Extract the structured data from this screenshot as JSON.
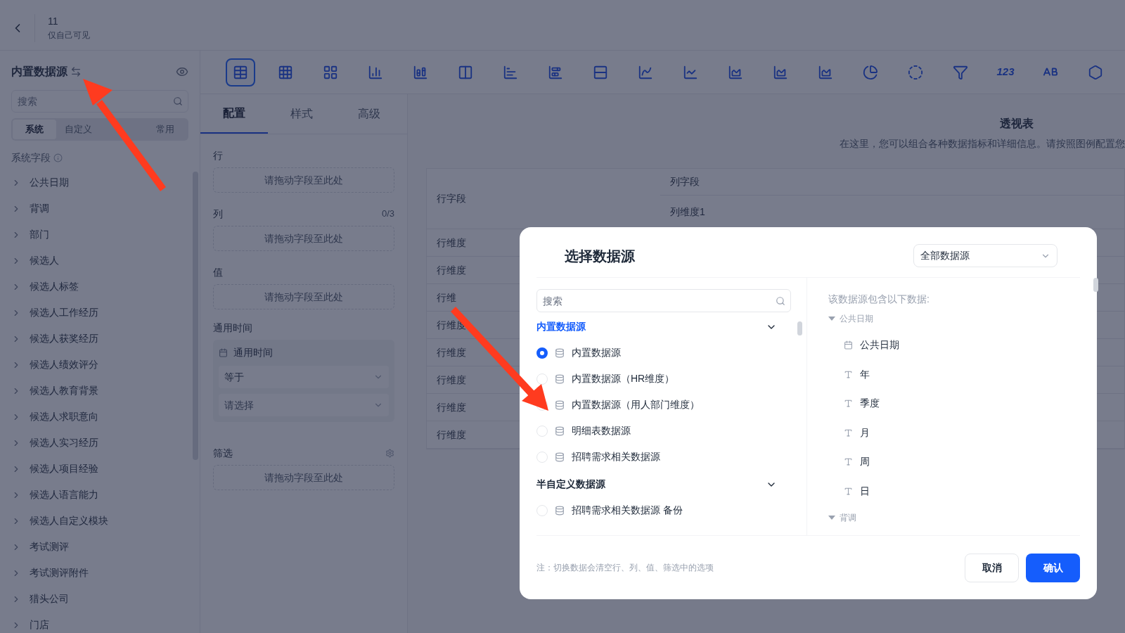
{
  "header": {
    "title": "11",
    "subtitle": "仅自己可见"
  },
  "sidebar": {
    "title": "内置数据源",
    "search": {
      "placeholder": "搜索"
    },
    "tabs": [
      {
        "label": "系统",
        "selected": true
      },
      {
        "label": "自定义",
        "selected": false
      },
      {
        "label": "常用",
        "selected": false
      }
    ],
    "section": "系统字段",
    "items": [
      {
        "label": "公共日期",
        "expanded": false
      },
      {
        "label": "背调",
        "expanded": false
      },
      {
        "label": "部门",
        "expanded": false
      },
      {
        "label": "候选人",
        "expanded": false
      },
      {
        "label": "候选人标签",
        "expanded": false
      },
      {
        "label": "候选人工作经历",
        "expanded": false
      },
      {
        "label": "候选人获奖经历",
        "expanded": false
      },
      {
        "label": "候选人绩效评分",
        "expanded": false
      },
      {
        "label": "候选人教育背景",
        "expanded": false
      },
      {
        "label": "候选人求职意向",
        "expanded": false
      },
      {
        "label": "候选人实习经历",
        "expanded": false
      },
      {
        "label": "候选人项目经验",
        "expanded": false
      },
      {
        "label": "候选人语言能力",
        "expanded": false
      },
      {
        "label": "候选人自定义模块",
        "expanded": false
      },
      {
        "label": "考试测评",
        "expanded": false
      },
      {
        "label": "考试测评附件",
        "expanded": false
      },
      {
        "label": "猎头公司",
        "expanded": false
      },
      {
        "label": "门店",
        "expanded": false
      }
    ]
  },
  "toolbar": [
    {
      "kind": "pivot",
      "selected": true
    },
    {
      "kind": "grid",
      "selected": false
    },
    {
      "kind": "grid2",
      "selected": false
    },
    {
      "kind": "column",
      "selected": false
    },
    {
      "kind": "stacked-column",
      "selected": false
    },
    {
      "kind": "split-column",
      "selected": false
    },
    {
      "kind": "bar",
      "selected": false
    },
    {
      "kind": "stacked-bar",
      "selected": false
    },
    {
      "kind": "split-bar",
      "selected": false
    },
    {
      "kind": "combo",
      "selected": false
    },
    {
      "kind": "line",
      "selected": false
    },
    {
      "kind": "area",
      "selected": false
    },
    {
      "kind": "stacked-area",
      "selected": false
    },
    {
      "kind": "area-box",
      "selected": false
    },
    {
      "kind": "pie",
      "selected": false
    },
    {
      "kind": "donut",
      "selected": false
    },
    {
      "kind": "funnel",
      "selected": false
    },
    {
      "kind": "number",
      "label": "123",
      "selected": false
    },
    {
      "kind": "text",
      "selected": false
    },
    {
      "kind": "hexagon",
      "selected": false
    }
  ],
  "config": {
    "tabs": [
      {
        "label": "配置",
        "selected": true
      },
      {
        "label": "样式",
        "selected": false
      },
      {
        "label": "高级",
        "selected": false
      }
    ],
    "rows": {
      "label": "行",
      "drop": "请拖动字段至此处"
    },
    "columns": {
      "label": "列",
      "count": "0/3",
      "drop": "请拖动字段至此处"
    },
    "values": {
      "label": "值",
      "drop": "请拖动字段至此处"
    },
    "time": {
      "label": "通用时间",
      "card_title": "通用时间",
      "operator": "等于",
      "value_placeholder": "请选择"
    },
    "filter": {
      "label": "筛选",
      "drop": "请拖动字段至此处"
    }
  },
  "preview": {
    "title": "透视表",
    "description": "在这里，您可以组合各种数据指标和详细信息。请按照图例配置您",
    "column_field": "列字段",
    "row_field": "行字段",
    "column_dim": "列维度1",
    "rows": [
      "行维度",
      "行维度",
      "行维",
      "行维度",
      "行维度",
      "行维度",
      "行维度",
      "行维度"
    ]
  },
  "dialog": {
    "title": "选择数据源",
    "scope": "全部数据源",
    "search": {
      "placeholder": "搜索"
    },
    "groups": [
      {
        "label": "内置数据源",
        "active": true,
        "items": [
          {
            "label": "内置数据源",
            "selected": true
          },
          {
            "label": "内置数据源（HR维度）",
            "selected": false
          },
          {
            "label": "内置数据源（用人部门维度）",
            "selected": false
          },
          {
            "label": "明细表数据源",
            "selected": false
          },
          {
            "label": "招聘需求相关数据源",
            "selected": false
          }
        ]
      },
      {
        "label": "半自定义数据源",
        "active": false,
        "items": [
          {
            "label": "招聘需求相关数据源 备份",
            "selected": false
          }
        ]
      }
    ],
    "contents_label": "该数据源包含以下数据:",
    "tree": [
      {
        "label": "公共日期",
        "expanded": true,
        "children": [
          {
            "label": "公共日期",
            "kind": "date"
          },
          {
            "label": "年",
            "kind": "text"
          },
          {
            "label": "季度",
            "kind": "text"
          },
          {
            "label": "月",
            "kind": "text"
          },
          {
            "label": "周",
            "kind": "text"
          },
          {
            "label": "日",
            "kind": "text"
          }
        ]
      },
      {
        "label": "背调",
        "expanded": true
      }
    ],
    "note": "注：切换数据会清空行、列、值、筛选中的选项",
    "cancel": "取消",
    "confirm": "确认"
  }
}
